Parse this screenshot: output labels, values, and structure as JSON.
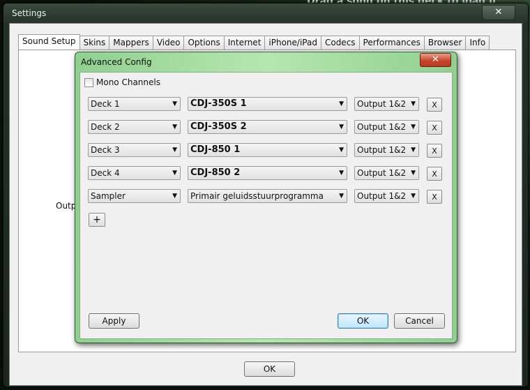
{
  "background": {
    "banner_text": "Drag a song on this deck to load it"
  },
  "settings": {
    "title": "Settings",
    "close_label": "✕",
    "tabs": [
      "Sound Setup",
      "Skins",
      "Mappers",
      "Video",
      "Options",
      "Internet",
      "iPhone/iPad",
      "Codecs",
      "Performances",
      "Browser",
      "Info"
    ],
    "active_tab": "Sound Setup",
    "outputs_label": "Outputs",
    "ok_label": "OK"
  },
  "advanced": {
    "title": "Advanced Config",
    "close_label": "✕",
    "mono_label": "Mono Channels",
    "rows": [
      {
        "deck": "Deck 1",
        "device": "CDJ-350S 1",
        "output": "Output 1&2",
        "remove": "X"
      },
      {
        "deck": "Deck 2",
        "device": "CDJ-350S 2",
        "output": "Output 1&2",
        "remove": "X"
      },
      {
        "deck": "Deck 3",
        "device": "CDJ-850 1",
        "output": "Output 1&2",
        "remove": "X"
      },
      {
        "deck": "Deck 4",
        "device": "CDJ-850 2",
        "output": "Output 1&2",
        "remove": "X"
      },
      {
        "deck": "Sampler",
        "device": "Primair geluidsstuurprogramma",
        "output": "Output 1&2",
        "remove": "X"
      }
    ],
    "add_label": "+",
    "apply_label": "Apply",
    "ok_label": "OK",
    "cancel_label": "Cancel"
  }
}
